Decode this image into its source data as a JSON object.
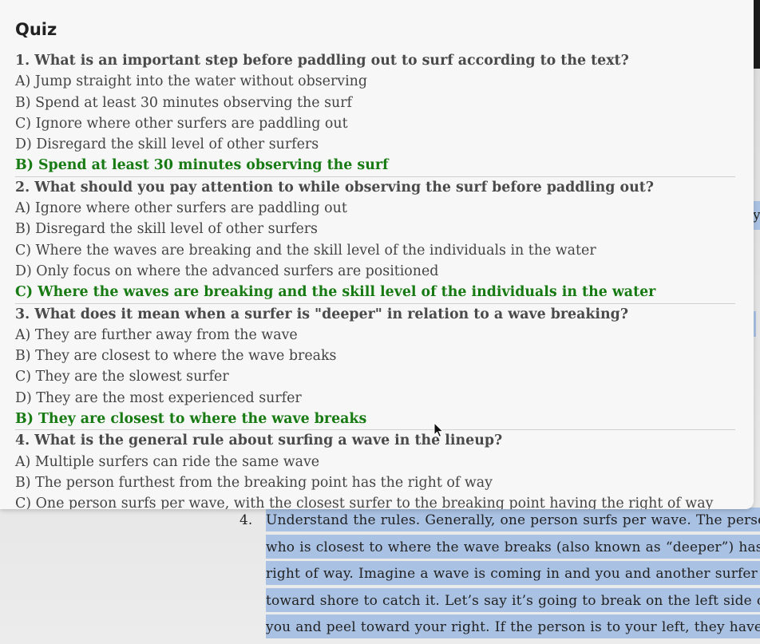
{
  "quiz": {
    "title": "Quiz",
    "questions": [
      {
        "question": "1. What is an important step before paddling out to surf according to the text?",
        "options": [
          "A) Jump straight into the water without observing",
          "B) Spend at least 30 minutes observing the surf",
          "C) Ignore where other surfers are paddling out",
          "D) Disregard the skill level of other surfers"
        ],
        "answer": "B) Spend at least 30 minutes observing the surf"
      },
      {
        "question": "2. What should you pay attention to while observing the surf before paddling out?",
        "options": [
          "A) Ignore where other surfers are paddling out",
          "B) Disregard the skill level of other surfers",
          "C) Where the waves are breaking and the skill level of the individuals in the water",
          "D) Only focus on where the advanced surfers are positioned"
        ],
        "answer": "C) Where the waves are breaking and the skill level of the individuals in the water"
      },
      {
        "question": "3. What does it mean when a surfer is \"deeper\" in relation to a wave breaking?",
        "options": [
          "A) They are further away from the wave",
          "B) They are closest to where the wave breaks",
          "C) They are the slowest surfer",
          "D) They are the most experienced surfer"
        ],
        "answer": "B) They are closest to where the wave breaks"
      },
      {
        "question": "4. What is the general rule about surfing a wave in the lineup?",
        "options": [
          "A) Multiple surfers can ride the same wave",
          "B) The person furthest from the breaking point has the right of way",
          "C) One person surfs per wave, with the closest surfer to the breaking point having the right of way"
        ]
      }
    ]
  },
  "document": {
    "list_number": "4.",
    "paragraph_lines": [
      "Understand the rules. Generally, one person surfs per wave. The person",
      "who is closest to where the wave breaks (also known as “deeper”) has the",
      "right of way. Imagine a wave is coming in and you and another surfer turn",
      "toward shore to catch it. Let’s say it’s going to break on the left side of",
      "you and peel toward your right. If the person is to your left, they have the"
    ],
    "side_fragment": "y"
  },
  "colors": {
    "answer_green": "#177a12",
    "highlight_blue": "#a9c1e3",
    "panel_bg": "#f7f7f7"
  },
  "icons": [
    "mouse-cursor-icon"
  ]
}
